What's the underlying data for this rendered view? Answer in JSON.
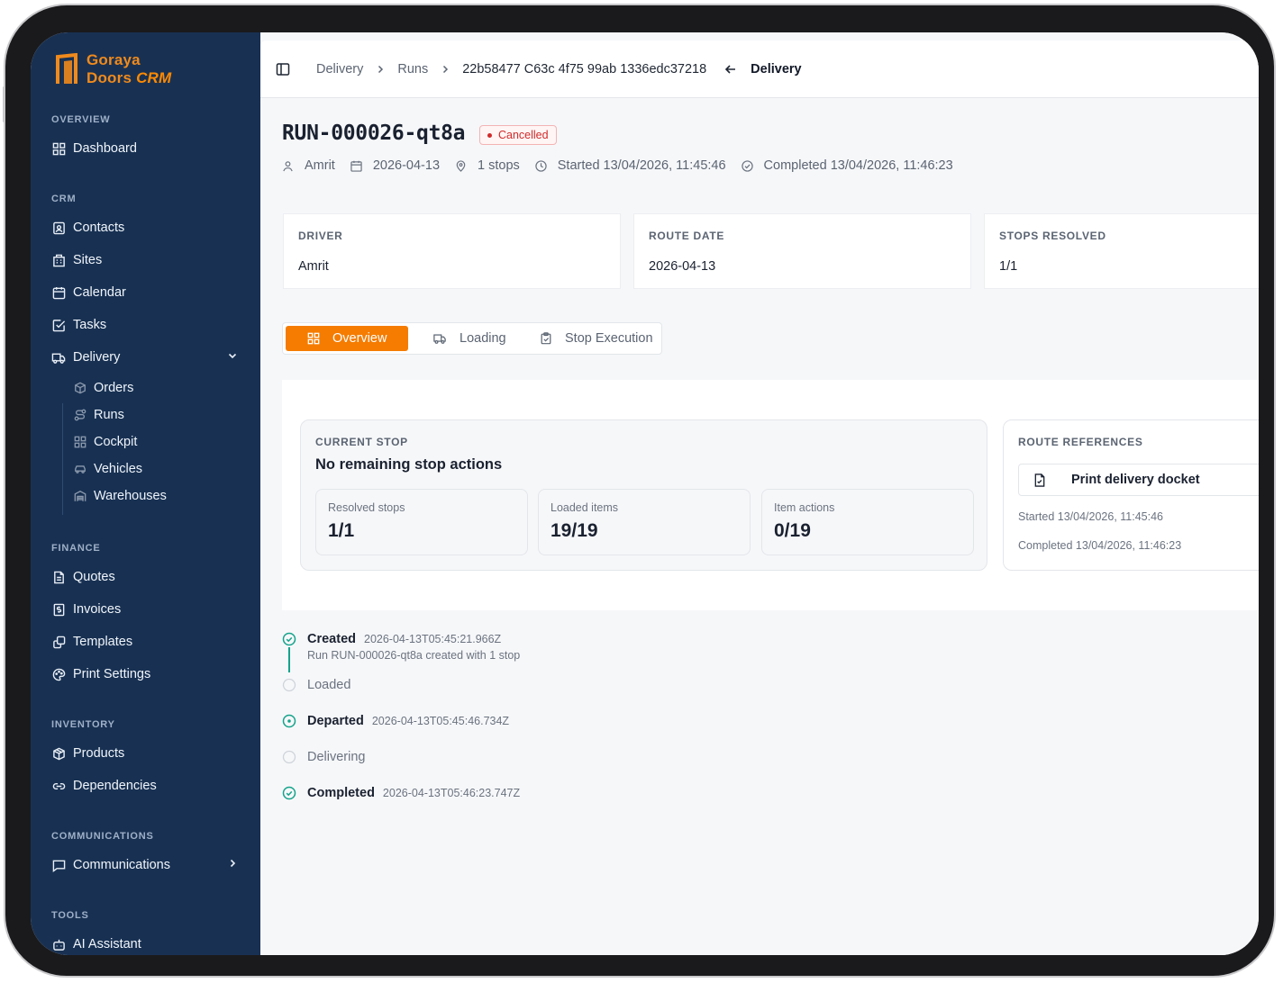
{
  "brand": {
    "line1": "Goraya",
    "line2": "Doors",
    "suffix": "CRM"
  },
  "sidebar": {
    "sections": {
      "overview": "OVERVIEW",
      "crm": "CRM",
      "finance": "FINANCE",
      "inventory": "INVENTORY",
      "communications": "COMMUNICATIONS",
      "tools": "TOOLS"
    },
    "items": {
      "dashboard": "Dashboard",
      "contacts": "Contacts",
      "sites": "Sites",
      "calendar": "Calendar",
      "tasks": "Tasks",
      "delivery": "Delivery",
      "orders": "Orders",
      "runs": "Runs",
      "cockpit": "Cockpit",
      "vehicles": "Vehicles",
      "warehouses": "Warehouses",
      "quotes": "Quotes",
      "invoices": "Invoices",
      "templates": "Templates",
      "print_settings": "Print Settings",
      "products": "Products",
      "dependencies": "Dependencies",
      "communications": "Communications",
      "ai_assistant": "AI Assistant"
    }
  },
  "breadcrumb": {
    "delivery": "Delivery",
    "runs": "Runs",
    "id": "22b58477 C63c 4f75 99ab 1336edc37218",
    "back": "Delivery"
  },
  "run": {
    "title": "RUN-000026-qt8a",
    "status": "Cancelled",
    "meta": {
      "driver": "Amrit",
      "date": "2026-04-13",
      "stops": "1 stops",
      "started": "Started 13/04/2026, 11:45:46",
      "completed": "Completed 13/04/2026, 11:46:23"
    }
  },
  "summary_cards": [
    {
      "label": "DRIVER",
      "value": "Amrit"
    },
    {
      "label": "ROUTE DATE",
      "value": "2026-04-13"
    },
    {
      "label": "STOPS RESOLVED",
      "value": "1/1"
    }
  ],
  "tabs": {
    "overview": "Overview",
    "loading": "Loading",
    "stop_execution": "Stop Execution"
  },
  "current_stop": {
    "label": "CURRENT STOP",
    "headline": "No remaining stop actions",
    "stats": [
      {
        "label": "Resolved stops",
        "value": "1/1"
      },
      {
        "label": "Loaded items",
        "value": "19/19"
      },
      {
        "label": "Item actions",
        "value": "0/19"
      }
    ]
  },
  "route_references": {
    "label": "ROUTE REFERENCES",
    "docket_button": "Print delivery docket",
    "started": "Started 13/04/2026, 11:45:46",
    "completed": "Completed 13/04/2026, 11:46:23"
  },
  "timeline": [
    {
      "title": "Created",
      "timestamp": "2026-04-13T05:45:21.966Z",
      "note": "Run RUN-000026-qt8a created with 1 stop",
      "done": true
    },
    {
      "title": "Loaded",
      "timestamp": "",
      "note": "",
      "done": false
    },
    {
      "title": "Departed",
      "timestamp": "2026-04-13T05:45:46.734Z",
      "note": "",
      "done": true
    },
    {
      "title": "Delivering",
      "timestamp": "",
      "note": "",
      "done": false
    },
    {
      "title": "Completed",
      "timestamp": "2026-04-13T05:46:23.747Z",
      "note": "",
      "done": true
    }
  ],
  "colors": {
    "sidebar_bg": "#183153",
    "accent": "#f57c00",
    "status_cancelled": "#d02b2b",
    "timeline_done": "#14a38b"
  }
}
